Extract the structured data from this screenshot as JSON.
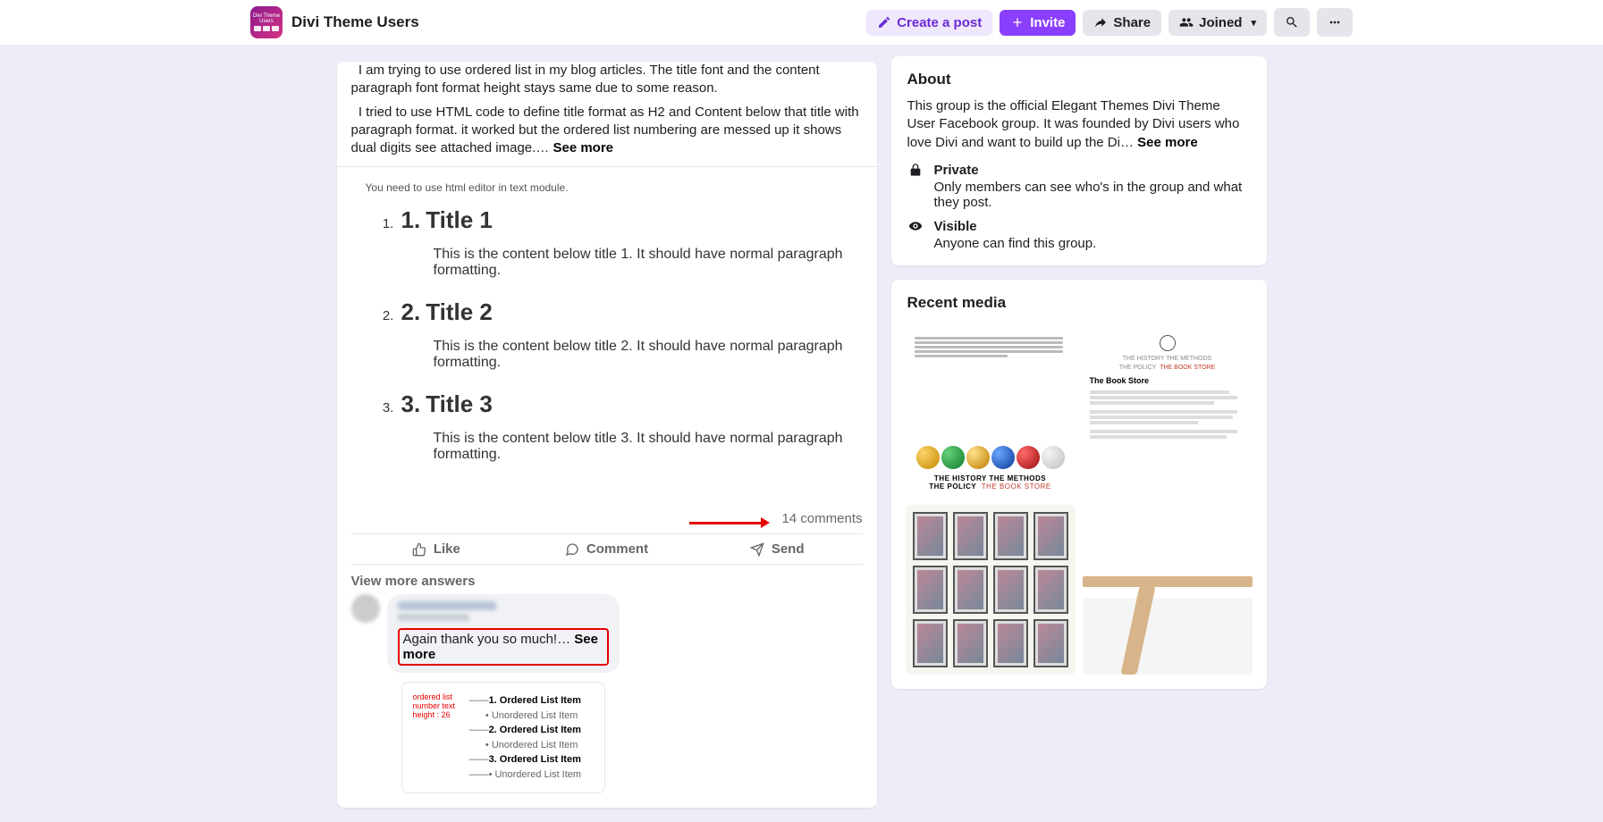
{
  "header": {
    "group_name": "Divi Theme Users",
    "create_post": "Create a post",
    "invite": "Invite",
    "share": "Share",
    "joined": "Joined"
  },
  "post": {
    "p1": "I am trying to use ordered list in my blog articles. The title font and the content paragraph font format height stays same due to some reason.",
    "p2": "I tried to use HTML code to define title format as H2 and Content below that title with paragraph format. it worked but the ordered list numbering are messed up it shows dual digits see attached image.…",
    "see_more": "See more",
    "embed_hint": "You need to use html editor in text module.",
    "items": [
      {
        "title": "Title 1",
        "body": "This is the content below title 1. It should have normal paragraph formatting."
      },
      {
        "title": "Title 2",
        "body": "This is the content below title 2. It should have normal paragraph formatting."
      },
      {
        "title": "Title 3",
        "body": "This is the content below title 3. It should have normal paragraph formatting."
      }
    ],
    "comments_count": "14 comments",
    "like": "Like",
    "comment": "Comment",
    "send": "Send",
    "view_more": "View more answers",
    "reply_text": "Again thank you so much!…",
    "reply_see_more": "See more",
    "nested_label": "ordered list\nnumber text\nheight : 26",
    "nested_items": [
      "1. Ordered List Item",
      "• Unordered List Item",
      "2. Ordered List Item",
      "• Unordered List Item",
      "3. Ordered List Item",
      "• Unordered List Item"
    ]
  },
  "sidebar": {
    "about_title": "About",
    "about_desc": "This group is the official Elegant Themes Divi Theme User Facebook group. It was founded by Divi users who love Divi and want to build up the Di…",
    "about_see_more": "See more",
    "private_title": "Private",
    "private_desc": "Only members can see who's in the group and what they post.",
    "visible_title": "Visible",
    "visible_desc": "Anyone can find this group.",
    "recent_media_title": "Recent media",
    "tile_a_footer_1": "THE HISTORY   THE METHODS",
    "tile_a_footer_2": "THE POLICY   THE BOOK STORE",
    "tile_b_header_1": "THE HISTORY   THE METHODS",
    "tile_b_header_2": "THE POLICY   THE BOOK STORE",
    "tile_b_title": "The Book Store"
  }
}
